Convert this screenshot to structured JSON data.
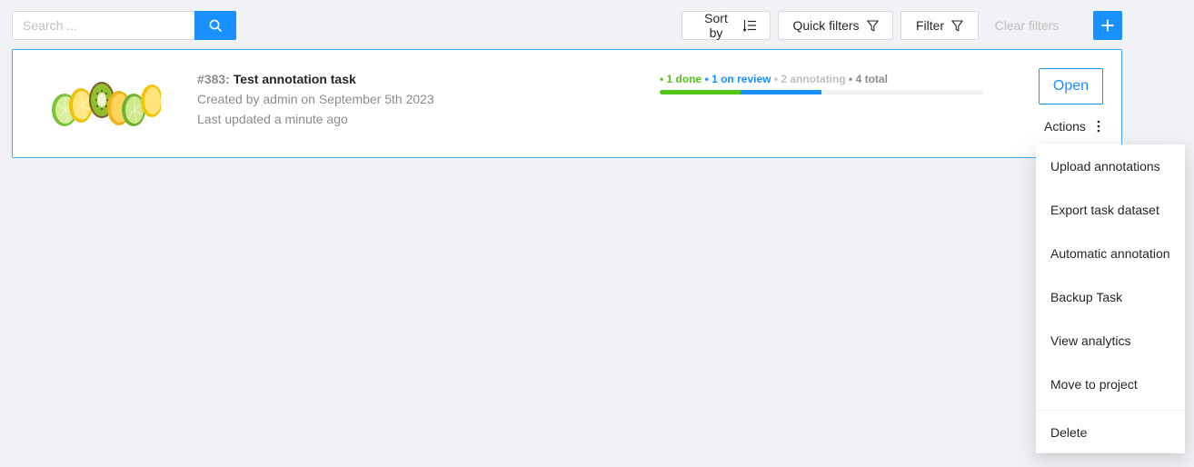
{
  "search": {
    "placeholder": "Search ..."
  },
  "toolbar": {
    "sort_label": "Sort by",
    "quick_filters_label": "Quick filters",
    "filter_label": "Filter",
    "clear_filters_label": "Clear filters"
  },
  "task": {
    "id": "#383:",
    "name": "Test annotation task",
    "created": "Created by admin on September 5th 2023",
    "updated": "Last updated a minute ago",
    "progress": {
      "done_label": "• 1 done",
      "review_label": "• 1 on review",
      "annotating_label": "• 2 annotating",
      "total_label": "• 4 total",
      "done": 1,
      "review": 1,
      "annotating": 2,
      "total": 4
    },
    "open_label": "Open",
    "actions_label": "Actions"
  },
  "actions_menu": {
    "items": [
      "Upload annotations",
      "Export task dataset",
      "Automatic annotation",
      "Backup Task",
      "View analytics",
      "Move to project",
      "Delete"
    ]
  },
  "colors": {
    "primary": "#1890ff",
    "done": "#52c41a",
    "annotating": "#bfbfbf",
    "background": "#f0f2f5"
  },
  "icons": {
    "search": "search-icon",
    "sort": "sort-list-icon",
    "filter": "funnel-icon",
    "add": "plus-icon",
    "more": "more-vertical-icon"
  }
}
